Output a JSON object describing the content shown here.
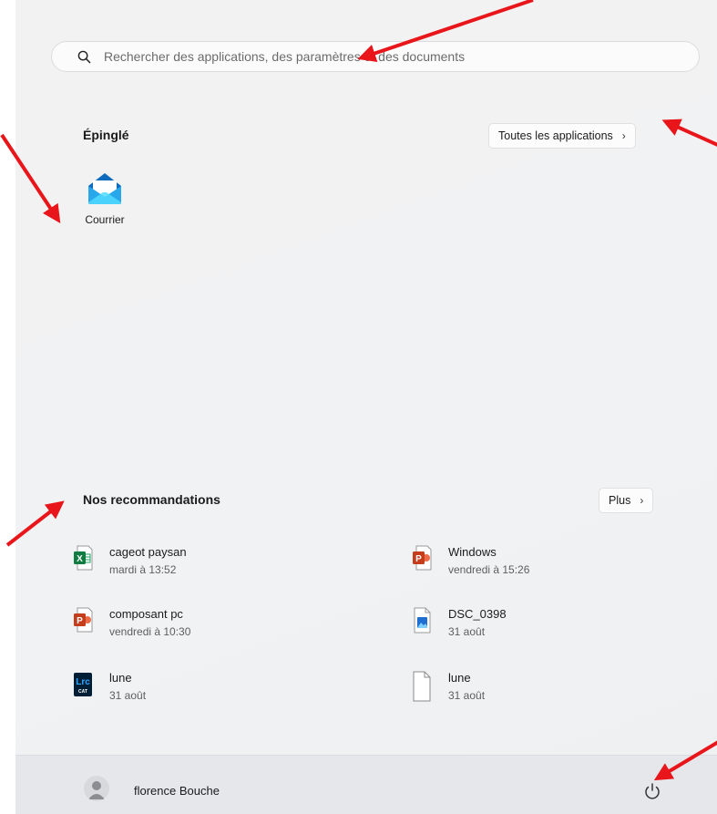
{
  "search": {
    "placeholder": "Rechercher des applications, des paramètres et des documents"
  },
  "pinned": {
    "title": "Épinglé",
    "all_apps_label": "Toutes les applications",
    "apps": [
      {
        "label": "Courrier",
        "icon": "mail-icon"
      }
    ]
  },
  "recommended": {
    "title": "Nos recommandations",
    "more_label": "Plus",
    "items": [
      {
        "name": "cageot paysan",
        "time": "mardi à 13:52",
        "icon": "excel-file-icon"
      },
      {
        "name": "Windows",
        "time": "vendredi à 15:26",
        "icon": "powerpoint-file-icon"
      },
      {
        "name": "composant pc",
        "time": "vendredi à 10:30",
        "icon": "powerpoint-file-icon"
      },
      {
        "name": "DSC_0398",
        "time": "31 août",
        "icon": "image-file-icon"
      },
      {
        "name": "lune",
        "time": "31 août",
        "icon": "lightroom-catalog-icon"
      },
      {
        "name": "lune",
        "time": "31 août",
        "icon": "blank-file-icon"
      }
    ]
  },
  "footer": {
    "user_name": "florence Bouche"
  },
  "colors": {
    "annotation_arrow": "#e8161b",
    "excel_green": "#107c41",
    "powerpoint_orange": "#c43e1c",
    "mail_blue": "#0f6cbd"
  }
}
